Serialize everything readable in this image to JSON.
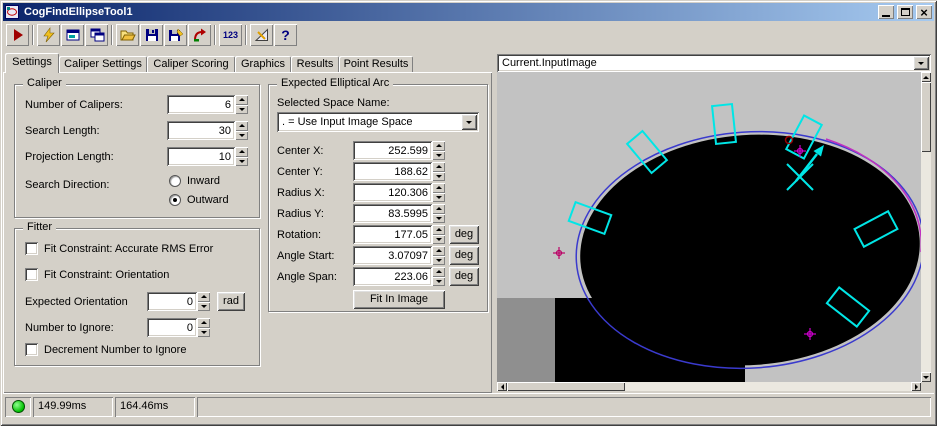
{
  "window": {
    "title": "CogFindEllipseTool1",
    "close_glyph": "×"
  },
  "toolbar": {
    "label_123": "123",
    "help_glyph": "?"
  },
  "tabs": [
    "Settings",
    "Caliper Settings",
    "Caliper Scoring",
    "Graphics",
    "Results",
    "Point Results"
  ],
  "caliper": {
    "legend": "Caliper",
    "rows": [
      {
        "label": "Number of Calipers:",
        "value": "6"
      },
      {
        "label": "Search Length:",
        "value": "30"
      },
      {
        "label": "Projection Length:",
        "value": "10"
      }
    ],
    "direction_label": "Search Direction:",
    "inward": "Inward",
    "outward": "Outward"
  },
  "fitter": {
    "legend": "Fitter",
    "rms_label": "Fit Constraint: Accurate RMS Error",
    "orientation_label": "Fit Constraint: Orientation",
    "expected_orientation_label": "Expected Orientation",
    "expected_orientation_value": "0",
    "rad_unit": "rad",
    "ignore_label": "Number to Ignore:",
    "ignore_value": "0",
    "decrement_label": "Decrement Number to Ignore"
  },
  "arc": {
    "legend": "Expected Elliptical Arc",
    "space_label": "Selected Space Name:",
    "space_value": ". = Use Input Image Space",
    "rows": [
      {
        "label": "Center X:",
        "value": "252.599"
      },
      {
        "label": "Center Y:",
        "value": "188.62"
      },
      {
        "label": "Radius X:",
        "value": "120.306"
      },
      {
        "label": "Radius Y:",
        "value": "83.5995"
      },
      {
        "label": "Rotation:",
        "value": "177.05",
        "unit": "deg"
      },
      {
        "label": "Angle Start:",
        "value": "3.07097",
        "unit": "deg"
      },
      {
        "label": "Angle Span:",
        "value": "223.06",
        "unit": "deg"
      }
    ],
    "fit_button": "Fit In Image"
  },
  "image_panel": {
    "source": "Current.InputImage"
  },
  "status": {
    "time1": "149.99ms",
    "time2": "164.46ms"
  },
  "colors": {
    "caliper_cyan": "#00E6E6",
    "marker_magenta": "#CC00CC",
    "ellipse_blue": "#3A3ACD",
    "run_light_green": "#00D400",
    "titlebar_left": "#0A246A",
    "titlebar_right": "#A6CAF0"
  }
}
